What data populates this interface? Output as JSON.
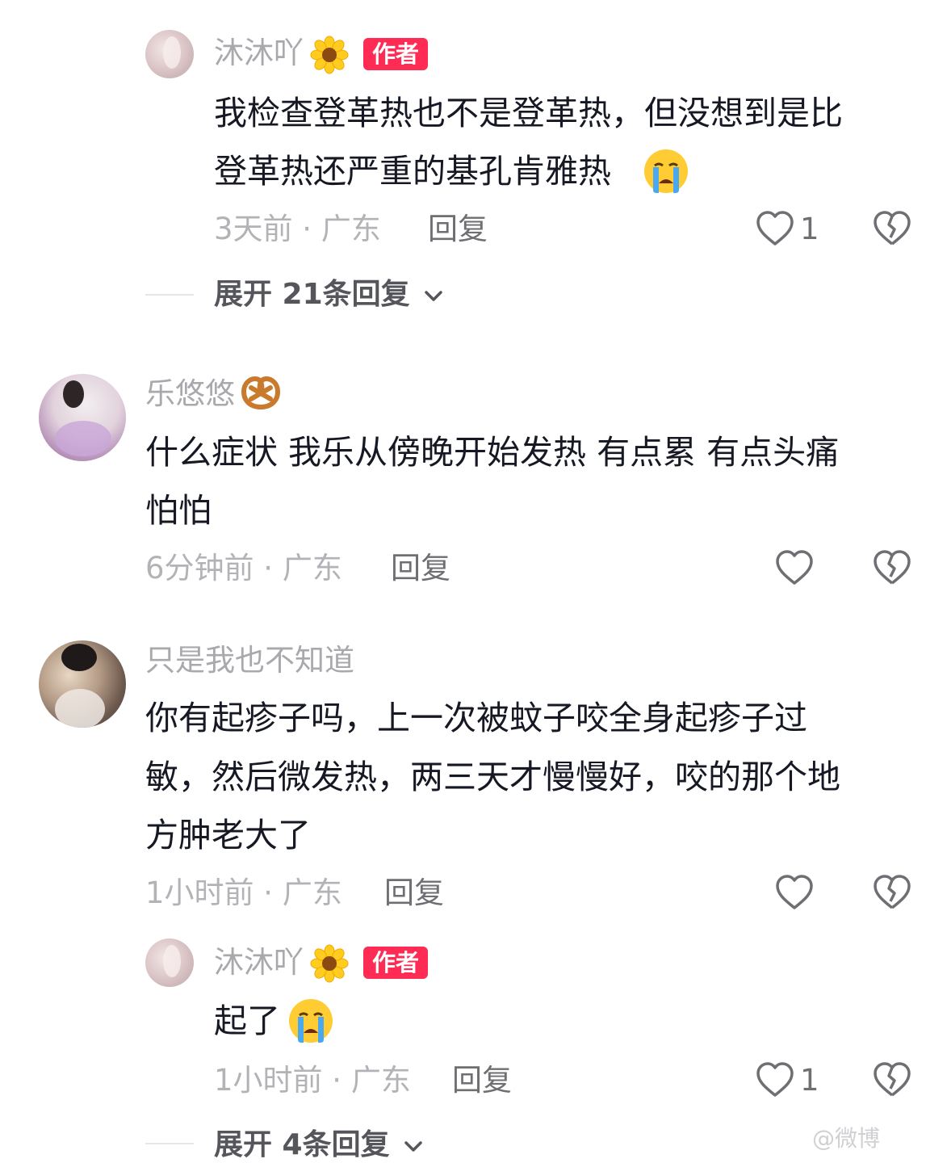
{
  "comments": [
    {
      "name": "沐沐吖",
      "name_emoji": "sunflower",
      "badge": "作者",
      "line1": "我检查登革热也不是登革热，但没想到是比",
      "line2": "登革热还严重的基孔肯雅热",
      "text_emoji": "crying-face",
      "meta": "3天前 · 广东",
      "reply": "回复",
      "likes": "1",
      "expand": "展开 21条回复"
    },
    {
      "name": "乐悠悠",
      "name_emoji": "pretzel",
      "line1": "什么症状 我乐从傍晚开始发热 有点累 有点头痛",
      "line2": "怕怕",
      "meta": "6分钟前 · 广东",
      "reply": "回复"
    },
    {
      "name": "只是我也不知道",
      "line1": "你有起疹子吗，上一次被蚊子咬全身起疹子过",
      "line2": "敏，然后微发热，两三天才慢慢好，咬的那个地",
      "line3": "方肿老大了",
      "meta": "1小时前 · 广东",
      "reply": "回复"
    },
    {
      "name": "沐沐吖",
      "name_emoji": "sunflower",
      "badge": "作者",
      "line1": "起了",
      "text_emoji": "crying-face",
      "meta": "1小时前 · 广东",
      "reply": "回复",
      "likes": "1",
      "expand": "展开 4条回复"
    }
  ],
  "watermark": "@微博"
}
